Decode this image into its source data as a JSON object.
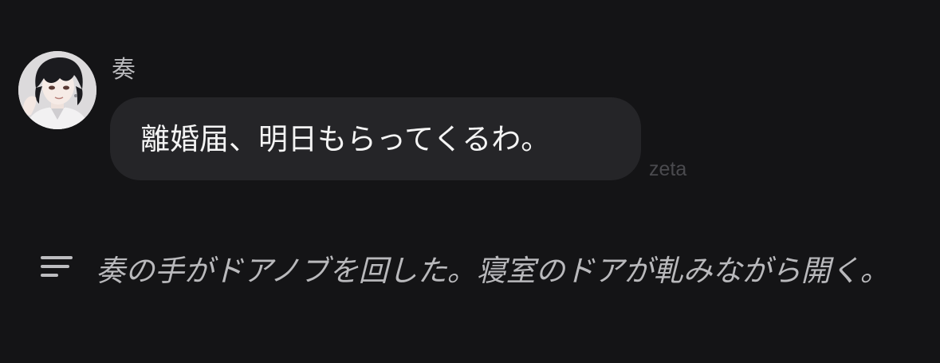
{
  "message": {
    "sender": "奏",
    "avatar_icon": "character-portrait-avatar",
    "text": "離婚届、明日もらってくるわ。",
    "watermark": "zeta"
  },
  "narration": {
    "icon": "text-lines-icon",
    "text": "奏の手がドアノブを回した。寝室のドアが軋みながら開く。"
  },
  "colors": {
    "background": "#141416",
    "bubble": "#252528",
    "bubble_text": "#f4f4f4",
    "secondary_text": "#b9b9bc"
  }
}
